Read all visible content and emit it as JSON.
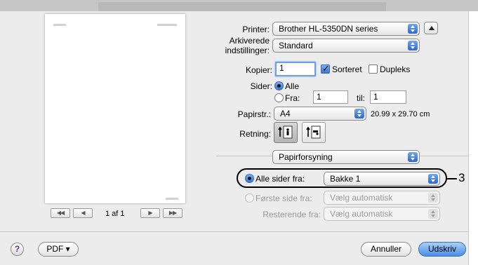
{
  "printer": {
    "label": "Printer:",
    "value": "Brother HL-5350DN series"
  },
  "presets": {
    "label_line1": "Arkiverede",
    "label_line2": "indstillinger:",
    "value": "Standard"
  },
  "copies": {
    "label": "Kopier:",
    "value": "1",
    "collated_label": "Sorteret",
    "collated": true,
    "duplex_label": "Dupleks",
    "duplex": false
  },
  "pages": {
    "label": "Sider:",
    "all_label": "Alle",
    "from_label": "Fra:",
    "from_value": "1",
    "to_label": "til:",
    "to_value": "1"
  },
  "paper": {
    "label": "Papirstr.:",
    "value": "A4",
    "size_text": "20.99 x 29.70 cm"
  },
  "orientation": {
    "label": "Retning:"
  },
  "section": {
    "value": "Papirforsyning"
  },
  "feed": {
    "all_pages_label": "Alle sider fra:",
    "all_pages_value": "Bakke 1",
    "first_page_label": "Første side fra:",
    "first_page_value": "Vælg automatisk",
    "remaining_label": "Resterende fra:",
    "remaining_value": "Vælg automatisk"
  },
  "callout": "3",
  "nav": {
    "first": "◀◀",
    "prev": "◀",
    "page_text": "1 af 1",
    "next": "▶",
    "last": "▶▶"
  },
  "bottom": {
    "help": "?",
    "pdf": "PDF ▾",
    "cancel": "Annuller",
    "print": "Udskriv"
  },
  "colors": {
    "accent": "#3a76d6",
    "dialog_bg": "#ececec"
  }
}
